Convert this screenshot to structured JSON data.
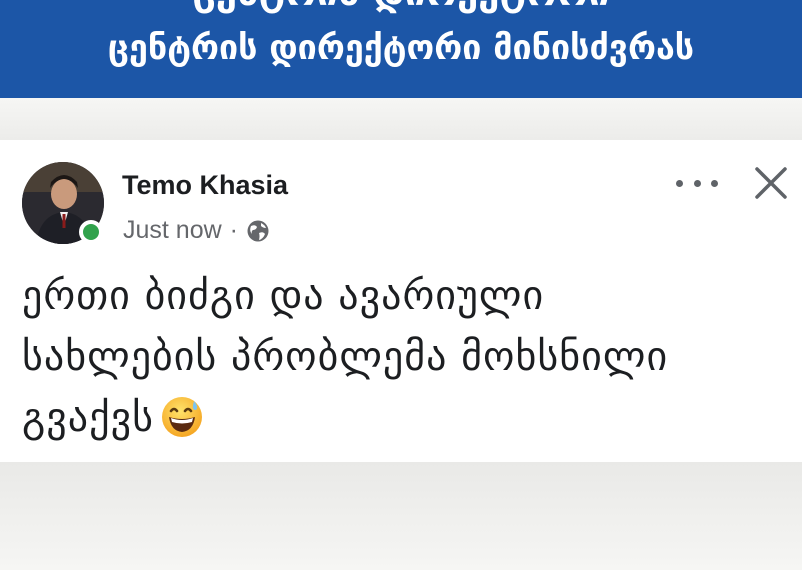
{
  "banner": {
    "title_partial": "ცენტრის დირექტორი მინისძვრას",
    "title": "ცენტრის დირექტორი მინისძვრას"
  },
  "post": {
    "author": "Temo Khasia",
    "timestamp": "Just now",
    "separator": "·",
    "privacy_icon": "globe-icon",
    "lines": [
      "ერთი ბიძგი და ავარიული",
      "სახლების პრობლემა მოხსნილი",
      "გვაქვს"
    ],
    "emoji": "grinning-face-with-sweat-icon",
    "online": true
  },
  "colors": {
    "banner": "#1c56a7",
    "online": "#31a24c",
    "secondary_text": "#65676b"
  }
}
